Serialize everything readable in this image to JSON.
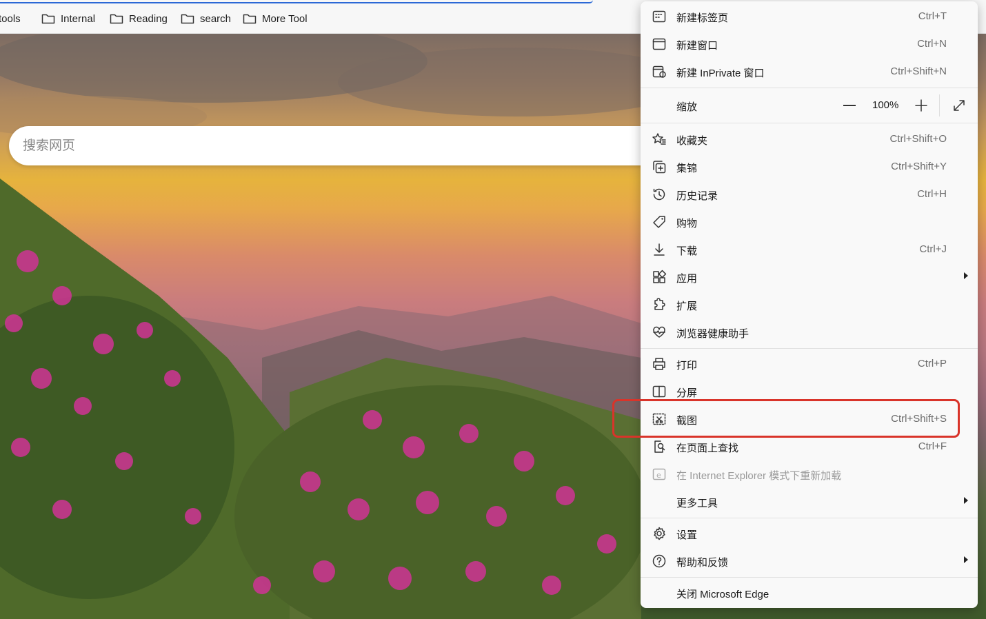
{
  "bookmarks": {
    "items": [
      {
        "label": "tools",
        "icon": "folder-icon"
      },
      {
        "label": "Internal",
        "icon": "folder-icon"
      },
      {
        "label": "Reading",
        "icon": "folder-icon"
      },
      {
        "label": "search",
        "icon": "folder-icon"
      },
      {
        "label": "More Tool",
        "icon": "folder-icon"
      }
    ]
  },
  "search": {
    "placeholder": "搜索网页"
  },
  "menu": {
    "new_tab": {
      "label": "新建标签页",
      "shortcut": "Ctrl+T"
    },
    "new_window": {
      "label": "新建窗口",
      "shortcut": "Ctrl+N"
    },
    "new_inprivate": {
      "label": "新建 InPrivate 窗口",
      "shortcut": "Ctrl+Shift+N"
    },
    "zoom": {
      "label": "缩放",
      "value": "100%"
    },
    "favorites": {
      "label": "收藏夹",
      "shortcut": "Ctrl+Shift+O"
    },
    "collections": {
      "label": "集锦",
      "shortcut": "Ctrl+Shift+Y"
    },
    "history": {
      "label": "历史记录",
      "shortcut": "Ctrl+H"
    },
    "shopping": {
      "label": "购物"
    },
    "downloads": {
      "label": "下载",
      "shortcut": "Ctrl+J"
    },
    "apps": {
      "label": "应用"
    },
    "extensions": {
      "label": "扩展"
    },
    "health": {
      "label": "浏览器健康助手"
    },
    "print": {
      "label": "打印",
      "shortcut": "Ctrl+P"
    },
    "split": {
      "label": "分屏"
    },
    "screenshot": {
      "label": "截图",
      "shortcut": "Ctrl+Shift+S"
    },
    "find": {
      "label": "在页面上查找",
      "shortcut": "Ctrl+F"
    },
    "ie_mode": {
      "label": "在 Internet Explorer 模式下重新加载"
    },
    "more_tools": {
      "label": "更多工具"
    },
    "settings": {
      "label": "设置"
    },
    "help": {
      "label": "帮助和反馈"
    },
    "close": {
      "label": "关闭 Microsoft Edge"
    }
  },
  "colors": {
    "highlight": "#d9342a",
    "accent": "#2b68d6"
  }
}
